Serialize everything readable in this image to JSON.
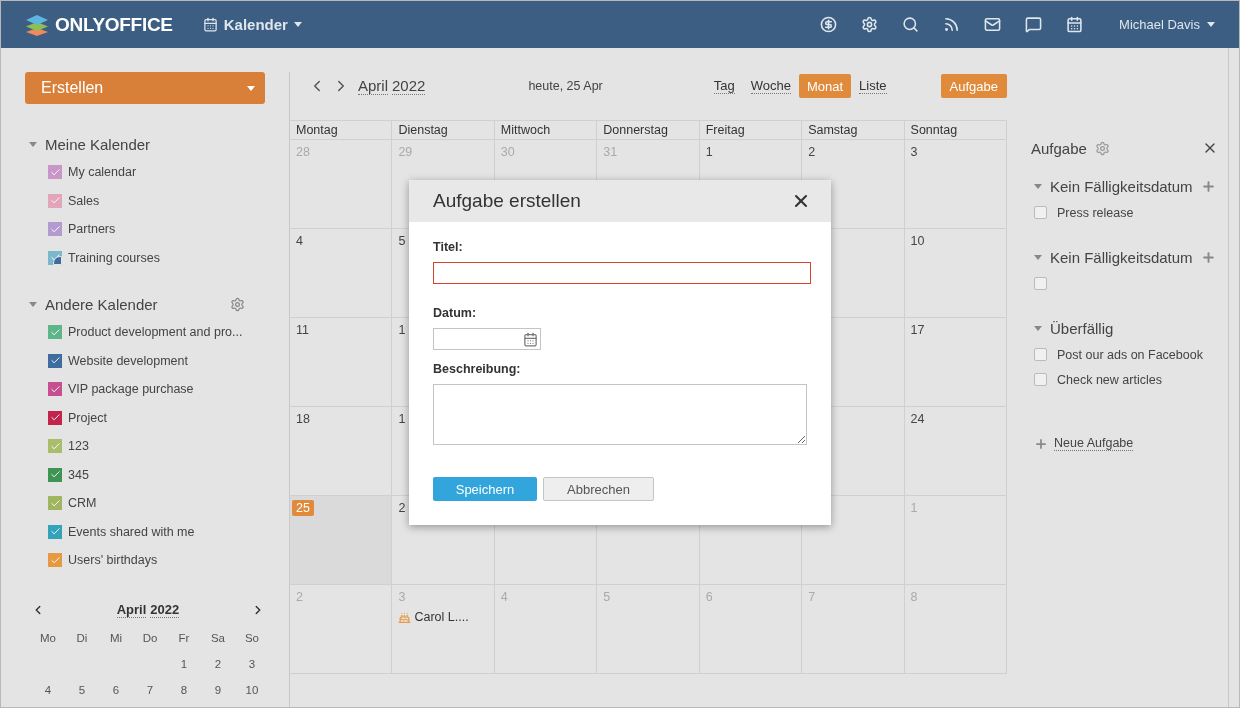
{
  "header": {
    "logo": "ONLYOFFICE",
    "module": "Kalender",
    "user": "Michael Davis"
  },
  "sidebar": {
    "create_button": "Erstellen",
    "sections": [
      {
        "title": "Meine Kalender",
        "expanded": true,
        "settings": false,
        "items": [
          {
            "label": "My calendar",
            "color": "#c897c8",
            "checked": true,
            "shared": false
          },
          {
            "label": "Sales",
            "color": "#e2a5b9",
            "checked": true,
            "shared": false
          },
          {
            "label": "Partners",
            "color": "#b39bd0",
            "checked": true,
            "shared": false
          },
          {
            "label": "Training courses",
            "color": "#7ab8cc",
            "checked": true,
            "shared": true
          }
        ]
      },
      {
        "title": "Andere Kalender",
        "expanded": true,
        "settings": true,
        "items": [
          {
            "label": "Product development and pro...",
            "color": "#5fb58a",
            "checked": true,
            "shared": false
          },
          {
            "label": "Website development",
            "color": "#3f6c9e",
            "checked": true,
            "shared": false
          },
          {
            "label": "VIP package purchase",
            "color": "#c74f91",
            "checked": true,
            "shared": false
          },
          {
            "label": "Project",
            "color": "#c2244c",
            "checked": true,
            "shared": false
          },
          {
            "label": "123",
            "color": "#a8be6a",
            "checked": true,
            "shared": false
          },
          {
            "label": "345",
            "color": "#3e9553",
            "checked": true,
            "shared": false
          },
          {
            "label": "CRM",
            "color": "#9fb560",
            "checked": true,
            "shared": false
          },
          {
            "label": "Events shared with me",
            "color": "#33a3bc",
            "checked": true,
            "shared": false
          },
          {
            "label": "Users' birthdays",
            "color": "#e59a41",
            "checked": true,
            "shared": false
          }
        ]
      }
    ],
    "mini_calendar": {
      "month": "April",
      "year": "2022",
      "weekdays": [
        "Mo",
        "Di",
        "Mi",
        "Do",
        "Fr",
        "Sa",
        "So"
      ],
      "weeks": [
        [
          "1",
          "2",
          "3"
        ],
        [
          "4",
          "5",
          "6",
          "7",
          "8",
          "9",
          "10"
        ]
      ]
    }
  },
  "toolbar": {
    "month": "April",
    "year": "2022",
    "today": "heute, 25 Apr",
    "views": [
      {
        "label": "Tag",
        "selected": false
      },
      {
        "label": "Woche",
        "selected": false
      },
      {
        "label": "Monat",
        "selected": true
      },
      {
        "label": "Liste",
        "selected": false
      }
    ],
    "task_button": "Aufgabe"
  },
  "month_grid": {
    "weekdays": [
      "Montag",
      "Dienstag",
      "Mittwoch",
      "Donnerstag",
      "Freitag",
      "Samstag",
      "Sonntag"
    ],
    "weeks": [
      {
        "start": [
          {
            "day": "28",
            "muted": true,
            "today": false
          },
          {
            "day": "29",
            "muted": true,
            "today": false
          },
          {
            "day": "30",
            "muted": true,
            "today": false
          },
          {
            "day": "31",
            "muted": true,
            "today": false
          },
          {
            "day": "1",
            "muted": false,
            "today": false
          },
          {
            "day": "2",
            "muted": false,
            "today": false
          },
          {
            "day": "3",
            "muted": false,
            "today": false
          }
        ]
      },
      {
        "start": [
          {
            "day": "4",
            "muted": false,
            "today": false
          },
          {
            "day": "5",
            "muted": false,
            "today": false
          }
        ],
        "end": [
          {
            "day": "10",
            "muted": false,
            "today": false
          }
        ]
      },
      {
        "start": [
          {
            "day": "11",
            "muted": false,
            "today": false
          },
          {
            "day": "1",
            "muted": false,
            "today": false
          }
        ],
        "end": [
          {
            "day": "17",
            "muted": false,
            "today": false
          }
        ]
      },
      {
        "start": [
          {
            "day": "18",
            "muted": false,
            "today": false
          },
          {
            "day": "1",
            "muted": false,
            "today": false
          }
        ],
        "end": [
          {
            "day": "24",
            "muted": false,
            "today": false
          }
        ]
      },
      {
        "start": [
          {
            "day": "25",
            "muted": false,
            "today": true
          },
          {
            "day": "2",
            "muted": false,
            "today": false
          }
        ],
        "end": [
          {
            "day": "1",
            "muted": true,
            "today": false
          }
        ]
      },
      {
        "start": [
          {
            "day": "2",
            "muted": true,
            "today": false
          },
          {
            "day": "3",
            "muted": true,
            "today": false,
            "events": [
              {
                "title": "Carol L....",
                "kind": "birthday"
              }
            ]
          },
          {
            "day": "4",
            "muted": true,
            "today": false
          },
          {
            "day": "5",
            "muted": true,
            "today": false
          },
          {
            "day": "6",
            "muted": true,
            "today": false
          },
          {
            "day": "7",
            "muted": true,
            "today": false
          },
          {
            "day": "8",
            "muted": true,
            "today": false
          }
        ]
      }
    ]
  },
  "task_panel": {
    "title": "Aufgabe",
    "groups": [
      {
        "title": "Kein Fälligkeitsdatum",
        "expanded": true,
        "can_add": true,
        "tasks": [
          {
            "label": "Press release",
            "checked": false
          }
        ]
      },
      {
        "title": "Kein Fälligkeitsdatum",
        "expanded": true,
        "can_add": true,
        "tasks": [
          {
            "checked": false
          }
        ]
      },
      {
        "title": "Überfällig",
        "expanded": true,
        "can_add": false,
        "tasks": [
          {
            "label": "Post our ads on Facebook",
            "checked": false
          },
          {
            "label": "Check new articles",
            "checked": false
          }
        ]
      }
    ],
    "new_task": "Neue Aufgabe"
  },
  "dialog": {
    "title": "Aufgabe erstellen",
    "fields": [
      {
        "label": "Titel:",
        "kind": "text",
        "highlighted": true
      },
      {
        "label": "Datum:",
        "kind": "date",
        "highlighted": false
      },
      {
        "label": "Beschreibung:",
        "kind": "textarea",
        "highlighted": false
      }
    ],
    "buttons": [
      {
        "label": "Speichern",
        "kind": "primary"
      },
      {
        "label": "Abbrechen",
        "kind": "secondary"
      }
    ]
  }
}
